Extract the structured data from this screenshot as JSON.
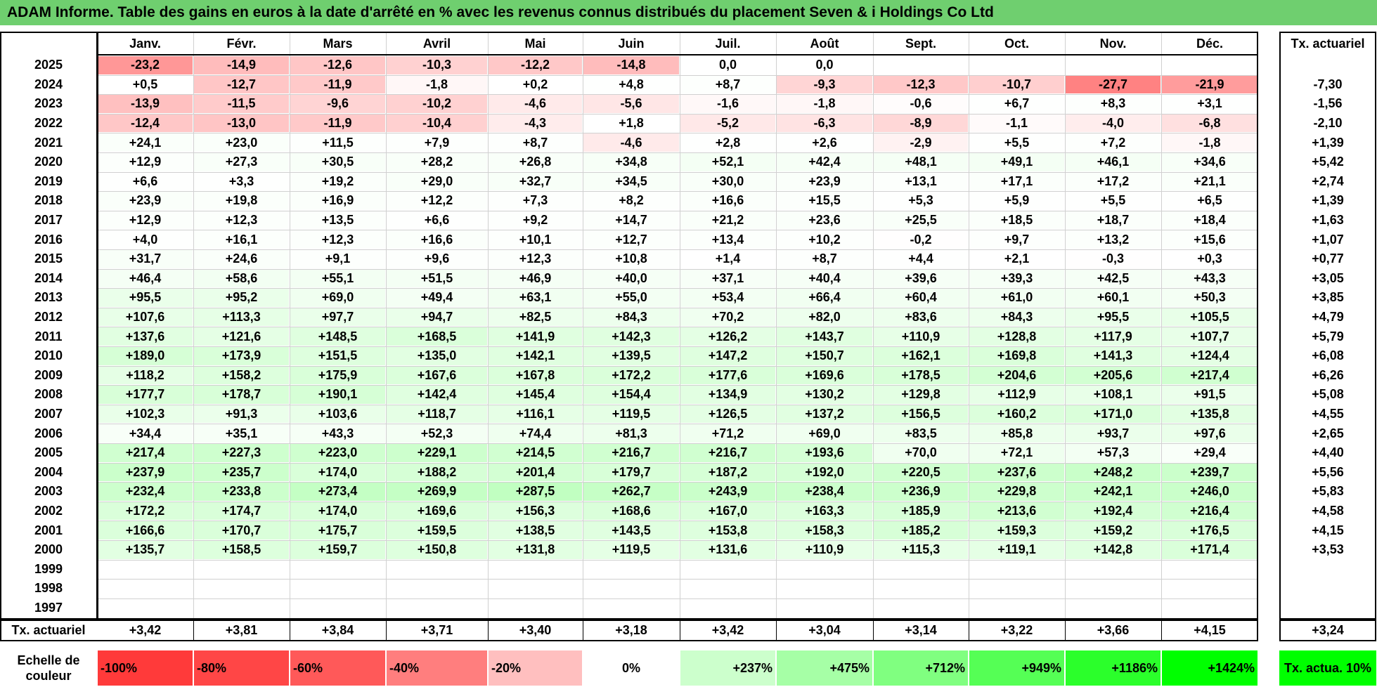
{
  "title": "ADAM Informe. Table des gains en euros à la date d'arrêté en % avec les revenus connus distribués du placement Seven & i Holdings Co Ltd",
  "chart_data": {
    "type": "table",
    "months": [
      "Janv.",
      "Févr.",
      "Mars",
      "Avril",
      "Mai",
      "Juin",
      "Juil.",
      "Août",
      "Sept.",
      "Oct.",
      "Nov.",
      "Déc."
    ],
    "rate_header": "Tx. actuariel",
    "rows": [
      {
        "year": "2025",
        "values": [
          "-23,2",
          "-14,9",
          "-12,6",
          "-10,3",
          "-12,2",
          "-14,8",
          "0,0",
          "0,0",
          "",
          "",
          "",
          ""
        ],
        "rate": ""
      },
      {
        "year": "2024",
        "values": [
          "+0,5",
          "-12,7",
          "-11,9",
          "-1,8",
          "+0,2",
          "+4,8",
          "+8,7",
          "-9,3",
          "-12,3",
          "-10,7",
          "-27,7",
          "-21,9"
        ],
        "rate": "-7,30"
      },
      {
        "year": "2023",
        "values": [
          "-13,9",
          "-11,5",
          "-9,6",
          "-10,2",
          "-4,6",
          "-5,6",
          "-1,6",
          "-1,8",
          "-0,6",
          "+6,7",
          "+8,3",
          "+3,1"
        ],
        "rate": "-1,56"
      },
      {
        "year": "2022",
        "values": [
          "-12,4",
          "-13,0",
          "-11,9",
          "-10,4",
          "-4,3",
          "+1,8",
          "-5,2",
          "-6,3",
          "-8,9",
          "-1,1",
          "-4,0",
          "-6,8"
        ],
        "rate": "-2,10"
      },
      {
        "year": "2021",
        "values": [
          "+24,1",
          "+23,0",
          "+11,5",
          "+7,9",
          "+8,7",
          "-4,6",
          "+2,8",
          "+2,6",
          "-2,9",
          "+5,5",
          "+7,2",
          "-1,8"
        ],
        "rate": "+1,39"
      },
      {
        "year": "2020",
        "values": [
          "+12,9",
          "+27,3",
          "+30,5",
          "+28,2",
          "+26,8",
          "+34,8",
          "+52,1",
          "+42,4",
          "+48,1",
          "+49,1",
          "+46,1",
          "+34,6"
        ],
        "rate": "+5,42"
      },
      {
        "year": "2019",
        "values": [
          "+6,6",
          "+3,3",
          "+19,2",
          "+29,0",
          "+32,7",
          "+34,5",
          "+30,0",
          "+23,9",
          "+13,1",
          "+17,1",
          "+17,2",
          "+21,1"
        ],
        "rate": "+2,74"
      },
      {
        "year": "2018",
        "values": [
          "+23,9",
          "+19,8",
          "+16,9",
          "+12,2",
          "+7,3",
          "+8,2",
          "+16,6",
          "+15,5",
          "+5,3",
          "+5,9",
          "+5,5",
          "+6,5"
        ],
        "rate": "+1,39"
      },
      {
        "year": "2017",
        "values": [
          "+12,9",
          "+12,3",
          "+13,5",
          "+6,6",
          "+9,2",
          "+14,7",
          "+21,2",
          "+23,6",
          "+25,5",
          "+18,5",
          "+18,7",
          "+18,4"
        ],
        "rate": "+1,63"
      },
      {
        "year": "2016",
        "values": [
          "+4,0",
          "+16,1",
          "+12,3",
          "+16,6",
          "+10,1",
          "+12,7",
          "+13,4",
          "+10,2",
          "-0,2",
          "+9,7",
          "+13,2",
          "+15,6"
        ],
        "rate": "+1,07"
      },
      {
        "year": "2015",
        "values": [
          "+31,7",
          "+24,6",
          "+9,1",
          "+9,6",
          "+12,3",
          "+10,8",
          "+1,4",
          "+8,7",
          "+4,4",
          "+2,1",
          "-0,3",
          "+0,3"
        ],
        "rate": "+0,77"
      },
      {
        "year": "2014",
        "values": [
          "+46,4",
          "+58,6",
          "+55,1",
          "+51,5",
          "+46,9",
          "+40,0",
          "+37,1",
          "+40,4",
          "+39,6",
          "+39,3",
          "+42,5",
          "+43,3"
        ],
        "rate": "+3,05"
      },
      {
        "year": "2013",
        "values": [
          "+95,5",
          "+95,2",
          "+69,0",
          "+49,4",
          "+63,1",
          "+55,0",
          "+53,4",
          "+66,4",
          "+60,4",
          "+61,0",
          "+60,1",
          "+50,3"
        ],
        "rate": "+3,85"
      },
      {
        "year": "2012",
        "values": [
          "+107,6",
          "+113,3",
          "+97,7",
          "+94,7",
          "+82,5",
          "+84,3",
          "+70,2",
          "+82,0",
          "+83,6",
          "+84,3",
          "+95,5",
          "+105,5"
        ],
        "rate": "+4,79"
      },
      {
        "year": "2011",
        "values": [
          "+137,6",
          "+121,6",
          "+148,5",
          "+168,5",
          "+141,9",
          "+142,3",
          "+126,2",
          "+143,7",
          "+110,9",
          "+128,8",
          "+117,9",
          "+107,7"
        ],
        "rate": "+5,79"
      },
      {
        "year": "2010",
        "values": [
          "+189,0",
          "+173,9",
          "+151,5",
          "+135,0",
          "+142,1",
          "+139,5",
          "+147,2",
          "+150,7",
          "+162,1",
          "+169,8",
          "+141,3",
          "+124,4"
        ],
        "rate": "+6,08"
      },
      {
        "year": "2009",
        "values": [
          "+118,2",
          "+158,2",
          "+175,9",
          "+167,6",
          "+167,8",
          "+172,2",
          "+177,6",
          "+169,6",
          "+178,5",
          "+204,6",
          "+205,6",
          "+217,4"
        ],
        "rate": "+6,26"
      },
      {
        "year": "2008",
        "values": [
          "+177,7",
          "+178,7",
          "+190,1",
          "+142,4",
          "+145,4",
          "+154,4",
          "+134,9",
          "+130,2",
          "+129,8",
          "+112,9",
          "+108,1",
          "+91,5"
        ],
        "rate": "+5,08"
      },
      {
        "year": "2007",
        "values": [
          "+102,3",
          "+91,3",
          "+103,6",
          "+118,7",
          "+116,1",
          "+119,5",
          "+126,5",
          "+137,2",
          "+156,5",
          "+160,2",
          "+171,0",
          "+135,8"
        ],
        "rate": "+4,55"
      },
      {
        "year": "2006",
        "values": [
          "+34,4",
          "+35,1",
          "+43,3",
          "+52,3",
          "+74,4",
          "+81,3",
          "+71,2",
          "+69,0",
          "+83,5",
          "+85,8",
          "+93,7",
          "+97,6"
        ],
        "rate": "+2,65"
      },
      {
        "year": "2005",
        "values": [
          "+217,4",
          "+227,3",
          "+223,0",
          "+229,1",
          "+214,5",
          "+216,7",
          "+216,7",
          "+193,6",
          "+70,0",
          "+72,1",
          "+57,3",
          "+29,4"
        ],
        "rate": "+4,40"
      },
      {
        "year": "2004",
        "values": [
          "+237,9",
          "+235,7",
          "+174,0",
          "+188,2",
          "+201,4",
          "+179,7",
          "+187,2",
          "+192,0",
          "+220,5",
          "+237,6",
          "+248,2",
          "+239,7"
        ],
        "rate": "+5,56"
      },
      {
        "year": "2003",
        "values": [
          "+232,4",
          "+233,8",
          "+273,4",
          "+269,9",
          "+287,5",
          "+262,7",
          "+243,9",
          "+238,4",
          "+236,9",
          "+229,8",
          "+242,1",
          "+246,0"
        ],
        "rate": "+5,83"
      },
      {
        "year": "2002",
        "values": [
          "+172,2",
          "+174,7",
          "+174,0",
          "+169,6",
          "+156,3",
          "+168,6",
          "+167,0",
          "+163,3",
          "+185,9",
          "+213,6",
          "+192,4",
          "+216,4"
        ],
        "rate": "+4,58"
      },
      {
        "year": "2001",
        "values": [
          "+166,6",
          "+170,7",
          "+175,7",
          "+159,5",
          "+138,5",
          "+143,5",
          "+153,8",
          "+158,3",
          "+185,2",
          "+159,3",
          "+159,2",
          "+176,5"
        ],
        "rate": "+4,15"
      },
      {
        "year": "2000",
        "values": [
          "+135,7",
          "+158,5",
          "+159,7",
          "+150,8",
          "+131,8",
          "+119,5",
          "+131,6",
          "+110,9",
          "+115,3",
          "+119,1",
          "+142,8",
          "+171,4"
        ],
        "rate": "+3,53"
      },
      {
        "year": "1999",
        "values": [
          "",
          "",
          "",
          "",
          "",
          "",
          "",
          "",
          "",
          "",
          "",
          ""
        ],
        "rate": ""
      },
      {
        "year": "1998",
        "values": [
          "",
          "",
          "",
          "",
          "",
          "",
          "",
          "",
          "",
          "",
          "",
          ""
        ],
        "rate": ""
      },
      {
        "year": "1997",
        "values": [
          "",
          "",
          "",
          "",
          "",
          "",
          "",
          "",
          "",
          "",
          "",
          ""
        ],
        "rate": ""
      }
    ],
    "footer": {
      "label": "Tx. actuariel",
      "values": [
        "+3,42",
        "+3,81",
        "+3,84",
        "+3,71",
        "+3,40",
        "+3,18",
        "+3,42",
        "+3,04",
        "+3,14",
        "+3,22",
        "+3,66",
        "+4,15"
      ],
      "total": "+3,24"
    },
    "color_scale": {
      "label": "Echelle de couleur",
      "steps": [
        {
          "text": "-100%",
          "color": "#ff3a3a"
        },
        {
          "text": "-80%",
          "color": "#ff4646"
        },
        {
          "text": "-60%",
          "color": "#ff5959"
        },
        {
          "text": "-40%",
          "color": "#ff7e7e"
        },
        {
          "text": "-20%",
          "color": "#ffbfbf"
        },
        {
          "text": "0%",
          "color": "#ffffff"
        },
        {
          "text": "+237%",
          "color": "#ccffcc"
        },
        {
          "text": "+475%",
          "color": "#a6ffa6"
        },
        {
          "text": "+712%",
          "color": "#80ff80"
        },
        {
          "text": "+949%",
          "color": "#55ff55"
        },
        {
          "text": "+1186%",
          "color": "#2bff2b"
        },
        {
          "text": "+1424%",
          "color": "#00ff00"
        }
      ],
      "rate_box": "Tx. actua. 10%",
      "rate_box_color": "#00ff00"
    }
  }
}
